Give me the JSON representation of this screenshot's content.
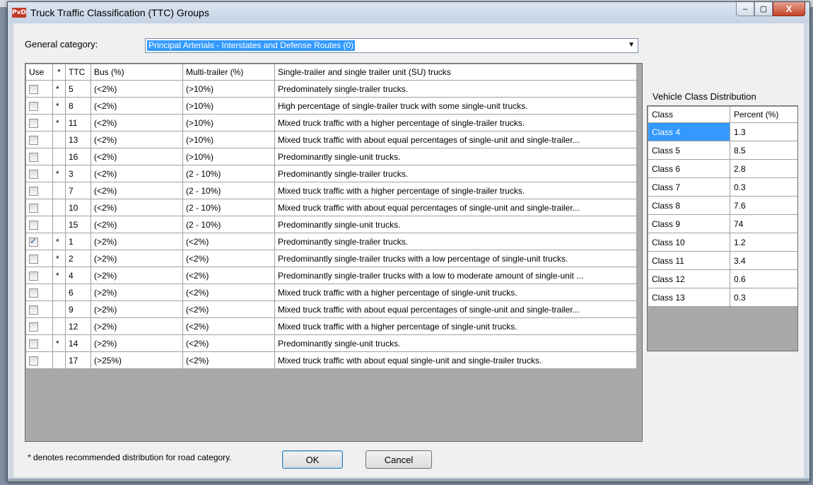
{
  "window": {
    "title": "Truck Traffic Classification (TTC) Groups",
    "app_icon": "PvD",
    "minimize": "–",
    "maximize": "▢",
    "close": "X"
  },
  "category": {
    "label": "General category:",
    "value": "Principal Arterials - Interstates and Defense Routes (0)",
    "arrow": "▼"
  },
  "ttc_table": {
    "headers": [
      "Use",
      "*",
      "TTC",
      "Bus (%)",
      "Multi-trailer (%)",
      "Single-trailer and single trailer unit (SU) trucks"
    ],
    "rows": [
      {
        "checked": false,
        "star": "*",
        "ttc": "5",
        "bus": "(<2%)",
        "multi": "(>10%)",
        "desc": "Predominately single-trailer trucks."
      },
      {
        "checked": false,
        "star": "*",
        "ttc": "8",
        "bus": "(<2%)",
        "multi": "(>10%)",
        "desc": "High percentage of single-trailer truck with some single-unit trucks."
      },
      {
        "checked": false,
        "star": "*",
        "ttc": "11",
        "bus": "(<2%)",
        "multi": "(>10%)",
        "desc": "Mixed truck traffic with a higher percentage of single-trailer trucks."
      },
      {
        "checked": false,
        "star": "",
        "ttc": "13",
        "bus": "(<2%)",
        "multi": "(>10%)",
        "desc": "Mixed truck traffic with about equal percentages of single-unit and single-trailer..."
      },
      {
        "checked": false,
        "star": "",
        "ttc": "16",
        "bus": "(<2%)",
        "multi": "(>10%)",
        "desc": "Predominantly single-unit trucks."
      },
      {
        "checked": false,
        "star": "*",
        "ttc": "3",
        "bus": "(<2%)",
        "multi": "(2 - 10%)",
        "desc": "Predominantly single-trailer trucks."
      },
      {
        "checked": false,
        "star": "",
        "ttc": "7",
        "bus": "(<2%)",
        "multi": "(2 - 10%)",
        "desc": "Mixed truck traffic with a higher percentage of single-trailer trucks."
      },
      {
        "checked": false,
        "star": "",
        "ttc": "10",
        "bus": "(<2%)",
        "multi": "(2 - 10%)",
        "desc": "Mixed truck traffic with about equal percentages of single-unit and single-trailer..."
      },
      {
        "checked": false,
        "star": "",
        "ttc": "15",
        "bus": "(<2%)",
        "multi": "(2 - 10%)",
        "desc": "Predominantly single-unit trucks."
      },
      {
        "checked": true,
        "star": "*",
        "ttc": "1",
        "bus": "(>2%)",
        "multi": "(<2%)",
        "desc": "Predominantly single-trailer trucks."
      },
      {
        "checked": false,
        "star": "*",
        "ttc": "2",
        "bus": "(>2%)",
        "multi": "(<2%)",
        "desc": "Predominantly single-trailer trucks with a low percentage of single-unit trucks."
      },
      {
        "checked": false,
        "star": "*",
        "ttc": "4",
        "bus": "(>2%)",
        "multi": "(<2%)",
        "desc": "Predominantly single-trailer trucks with a low to moderate amount of single-unit ..."
      },
      {
        "checked": false,
        "star": "",
        "ttc": "6",
        "bus": "(>2%)",
        "multi": "(<2%)",
        "desc": "Mixed truck traffic with a higher percentage of single-unit trucks."
      },
      {
        "checked": false,
        "star": "",
        "ttc": "9",
        "bus": "(>2%)",
        "multi": "(<2%)",
        "desc": "Mixed truck traffic with about equal percentages of single-unit and single-trailer..."
      },
      {
        "checked": false,
        "star": "",
        "ttc": "12",
        "bus": "(>2%)",
        "multi": "(<2%)",
        "desc": "Mixed truck traffic with a higher percentage of single-unit trucks."
      },
      {
        "checked": false,
        "star": "*",
        "ttc": "14",
        "bus": "(>2%)",
        "multi": "(<2%)",
        "desc": "Predominantly single-unit trucks."
      },
      {
        "checked": false,
        "star": "",
        "ttc": "17",
        "bus": "(>25%)",
        "multi": "(<2%)",
        "desc": "Mixed truck traffic with about equal single-unit and single-trailer trucks."
      }
    ]
  },
  "vcd": {
    "label": "Vehicle Class Distribution",
    "headers": [
      "Class",
      "Percent (%)"
    ],
    "rows": [
      {
        "cls": "Class 4",
        "pct": "1.3"
      },
      {
        "cls": "Class 5",
        "pct": "8.5"
      },
      {
        "cls": "Class 6",
        "pct": "2.8"
      },
      {
        "cls": "Class 7",
        "pct": "0.3"
      },
      {
        "cls": "Class 8",
        "pct": "7.6"
      },
      {
        "cls": "Class 9",
        "pct": "74"
      },
      {
        "cls": "Class 10",
        "pct": "1.2"
      },
      {
        "cls": "Class 11",
        "pct": "3.4"
      },
      {
        "cls": "Class 12",
        "pct": "0.6"
      },
      {
        "cls": "Class 13",
        "pct": "0.3"
      }
    ]
  },
  "footer": {
    "note": "* denotes recommended distribution for road category.",
    "ok": "OK",
    "cancel": "Cancel"
  },
  "colors": {
    "selection": "#3399ff",
    "grid_background": "#a9a9a9",
    "close_button": "#c2442a"
  }
}
